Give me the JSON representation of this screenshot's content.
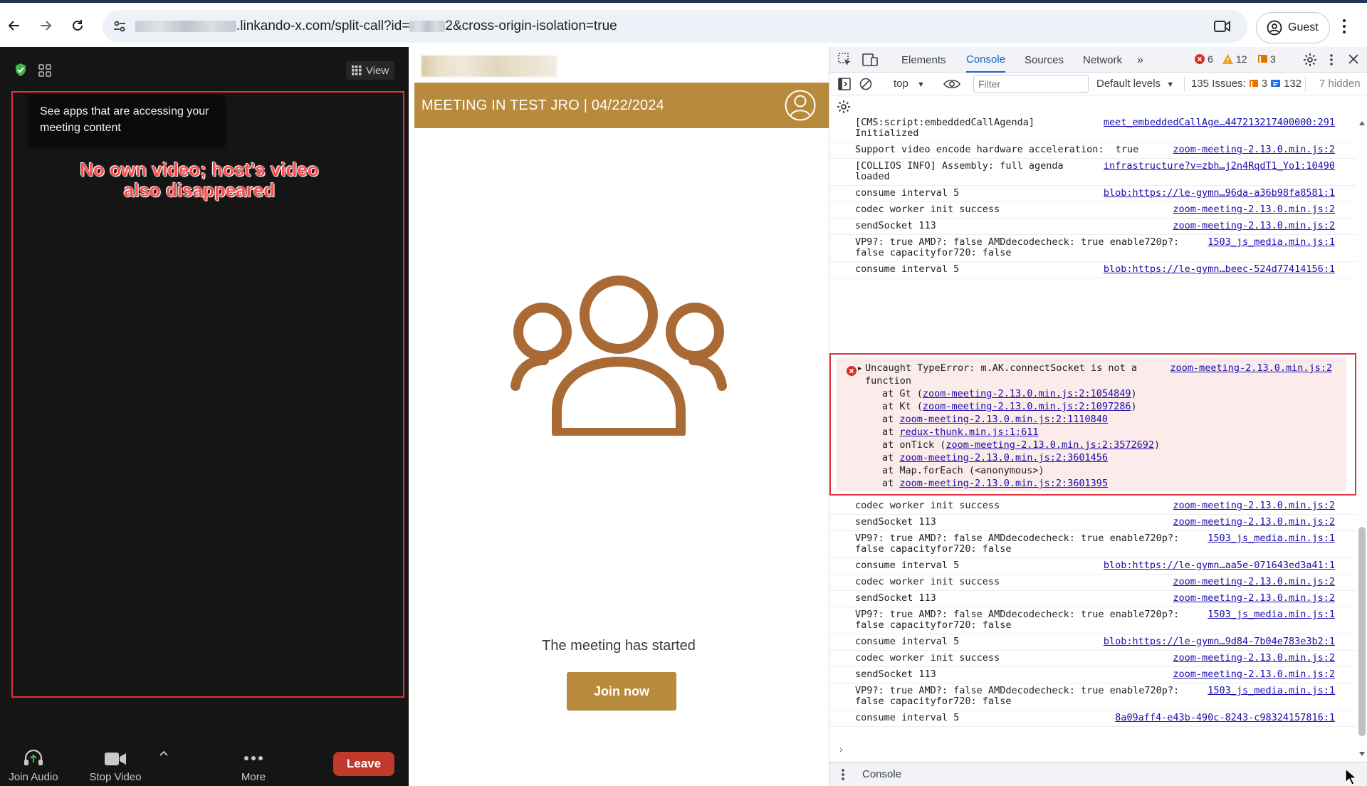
{
  "browser": {
    "url_suffix_1": ".linkando-x.com/split-call?id=",
    "url_suffix_2": "2&cross-origin-isolation=true",
    "profile_label": "Guest"
  },
  "zoom": {
    "view_label": "View",
    "tooltip": "See apps that are accessing your meeting content",
    "annotation_line1": "No own video; host's video",
    "annotation_line2": "also disappeared",
    "controls": {
      "join_audio": "Join Audio",
      "stop_video": "Stop Video",
      "more": "More",
      "leave": "Leave"
    }
  },
  "meeting_page": {
    "banner_title": "MEETING IN TEST JRO | 04/22/2024",
    "status_text": "The meeting has started",
    "join_button": "Join now",
    "brand_color": "#b88a3c"
  },
  "devtools": {
    "tabs": [
      "Elements",
      "Console",
      "Sources",
      "Network"
    ],
    "active_tab": "Console",
    "error_count": "6",
    "warning_count": "12",
    "issue_badge_count": "3",
    "context": "top",
    "filter_placeholder": "Filter",
    "levels": "Default levels",
    "issues_label": "135 Issues:",
    "issues_warn": "3",
    "issues_info": "132",
    "hidden": "7 hidden",
    "footer_tab": "Console",
    "messages_before": [
      {
        "text": "[CMS:script:embeddedCallAgenda]\nInitialized",
        "source": "meet_embeddedCallAge…447213217400000:291"
      },
      {
        "text": "Support video encode hardware acceleration:  true",
        "source": "zoom-meeting-2.13.0.min.js:2"
      },
      {
        "text": "[COLLIOS INFO] Assembly: full agenda\nloaded",
        "source": "infrastructure?v=zbh…j2n4RqdT1_Yo1:10490"
      },
      {
        "text": "consume interval 5",
        "source": "blob:https://le-gymn…96da-a36b98fa8581:1"
      },
      {
        "text": "codec worker init success",
        "source": "zoom-meeting-2.13.0.min.js:2"
      },
      {
        "text": "sendSocket 113",
        "source": "zoom-meeting-2.13.0.min.js:2"
      },
      {
        "text": "VP9?: true AMD?: false AMDdecodecheck: true enable720p?:\nfalse capacityfor720: false",
        "source": "1503_js_media.min.js:1"
      },
      {
        "text": "consume interval 5",
        "source": "blob:https://le-gymn…beec-524d77414156:1"
      }
    ],
    "error": {
      "message": "Uncaught TypeError: m.AK.connectSocket is not a\nfunction",
      "source": "zoom-meeting-2.13.0.min.js:2",
      "stack": [
        {
          "prefix": "at Gt (",
          "link": "zoom-meeting-2.13.0.min.js:2:1054849",
          "suffix": ")"
        },
        {
          "prefix": "at Kt (",
          "link": "zoom-meeting-2.13.0.min.js:2:1097286",
          "suffix": ")"
        },
        {
          "prefix": "at ",
          "link": "zoom-meeting-2.13.0.min.js:2:1110840",
          "suffix": ""
        },
        {
          "prefix": "at ",
          "link": "redux-thunk.min.js:1:611",
          "suffix": ""
        },
        {
          "prefix": "at onTick (",
          "link": "zoom-meeting-2.13.0.min.js:2:3572692",
          "suffix": ")"
        },
        {
          "prefix": "at ",
          "link": "zoom-meeting-2.13.0.min.js:2:3601456",
          "suffix": ""
        },
        {
          "prefix": "at Map.forEach (<anonymous>)",
          "link": "",
          "suffix": ""
        },
        {
          "prefix": "at ",
          "link": "zoom-meeting-2.13.0.min.js:2:3601395",
          "suffix": ""
        }
      ]
    },
    "messages_after": [
      {
        "text": "codec worker init success",
        "source": "zoom-meeting-2.13.0.min.js:2"
      },
      {
        "text": "sendSocket 113",
        "source": "zoom-meeting-2.13.0.min.js:2"
      },
      {
        "text": "VP9?: true AMD?: false AMDdecodecheck: true enable720p?:\nfalse capacityfor720: false",
        "source": "1503_js_media.min.js:1"
      },
      {
        "text": "consume interval 5",
        "source": "blob:https://le-gymn…aa5e-071643ed3a41:1"
      },
      {
        "text": "codec worker init success",
        "source": "zoom-meeting-2.13.0.min.js:2"
      },
      {
        "text": "sendSocket 113",
        "source": "zoom-meeting-2.13.0.min.js:2"
      },
      {
        "text": "VP9?: true AMD?: false AMDdecodecheck: true enable720p?:\nfalse capacityfor720: false",
        "source": "1503_js_media.min.js:1"
      },
      {
        "text": "consume interval 5",
        "source": "blob:https://le-gymn…9d84-7b04e783e3b2:1"
      },
      {
        "text": "codec worker init success",
        "source": "zoom-meeting-2.13.0.min.js:2"
      },
      {
        "text": "sendSocket 113",
        "source": "zoom-meeting-2.13.0.min.js:2"
      },
      {
        "text": "VP9?: true AMD?: false AMDdecodecheck: true enable720p?:\nfalse capacityfor720: false",
        "source": "1503_js_media.min.js:1"
      },
      {
        "text": "consume interval 5",
        "source": "8a09aff4-e43b-490c-8243-c98324157816:1"
      }
    ]
  }
}
